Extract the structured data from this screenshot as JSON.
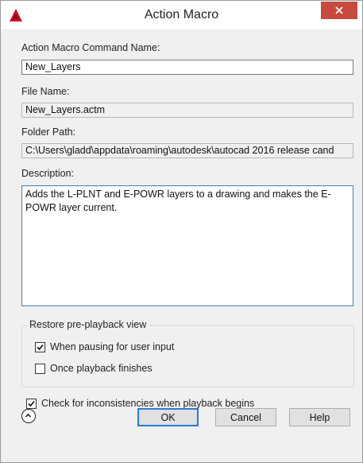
{
  "window": {
    "title": "Action Macro",
    "close_icon": "close-icon",
    "app_icon": "autocad-logo-icon",
    "accent_color": "#c74a3f"
  },
  "command_name": {
    "label": "Action Macro Command Name:",
    "value": "New_Layers"
  },
  "file_name": {
    "label": "File Name:",
    "value": "New_Layers.actm"
  },
  "folder_path": {
    "label": "Folder Path:",
    "value": "C:\\Users\\gladd\\appdata\\roaming\\autodesk\\autocad 2016 release cand"
  },
  "description": {
    "label": "Description:",
    "value": "Adds the L-PLNT and E-POWR layers to a drawing and makes the E-POWR layer current."
  },
  "restore_group": {
    "title": "Restore pre-playback view",
    "options": [
      {
        "label": "When pausing for user input",
        "checked": true
      },
      {
        "label": "Once playback finishes",
        "checked": false
      }
    ]
  },
  "inconsistency_check": {
    "label": "Check for inconsistencies when playback begins",
    "checked": true
  },
  "buttons": {
    "ok": "OK",
    "cancel": "Cancel",
    "help": "Help",
    "collapse_icon": "chevron-up-icon"
  }
}
